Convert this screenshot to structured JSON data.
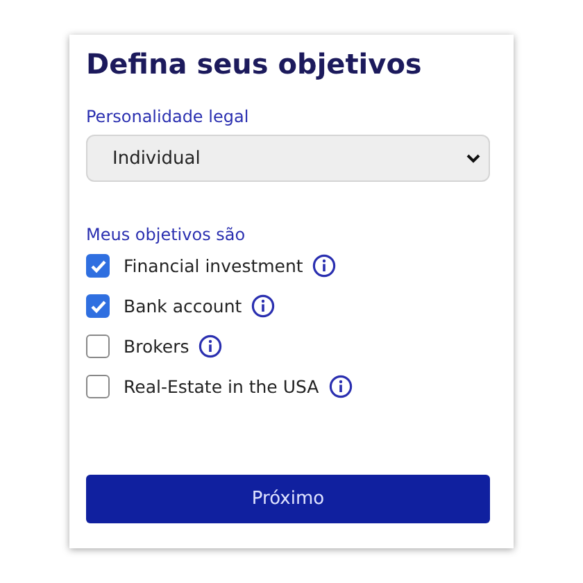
{
  "title": "Defina seus objetivos",
  "legal": {
    "label": "Personalidade legal",
    "value": "Individual"
  },
  "objectives": {
    "label": "Meus objetivos são",
    "items": [
      {
        "label": "Financial investment",
        "checked": true
      },
      {
        "label": "Bank account",
        "checked": true
      },
      {
        "label": "Brokers",
        "checked": false
      },
      {
        "label": "Real-Estate in the USA",
        "checked": false
      }
    ]
  },
  "button": "Próximo"
}
